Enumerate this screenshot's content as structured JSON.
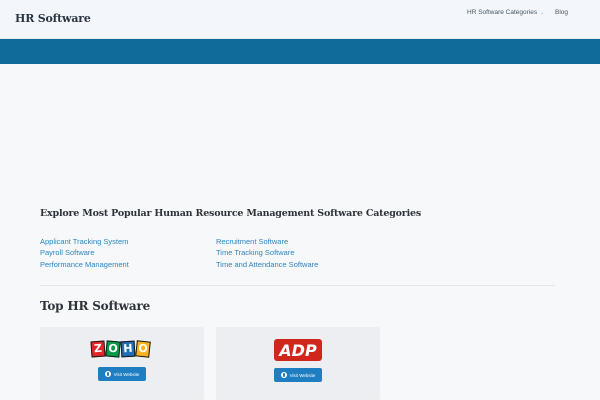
{
  "header": {
    "brand": "HR Software",
    "nav": [
      {
        "label": "HR Software Categories"
      },
      {
        "label": "Blog"
      }
    ]
  },
  "categories_section": {
    "title": "Explore Most Popular Human Resource Management Software Categories",
    "left_links": [
      "Applicant Tracking System",
      "Payroll Software",
      "Performance Management"
    ],
    "right_links": [
      "Recruitment Software",
      "Time Tracking Software",
      "Time and Attendance Software"
    ]
  },
  "top_section": {
    "title": "Top HR Software",
    "cards": [
      {
        "logo_letters": [
          "Z",
          "O",
          "H",
          "O"
        ],
        "logo_colors": [
          "#e42527",
          "#089949",
          "#226db4",
          "#f9b21d"
        ],
        "button_label": "Visit Website"
      },
      {
        "logo_text": "ADP",
        "logo_color": "#d0271d",
        "button_label": "Visit Website"
      }
    ]
  },
  "colors": {
    "band": "#0f6b9a",
    "link": "#2a86c2",
    "button": "#1f7ec1"
  }
}
